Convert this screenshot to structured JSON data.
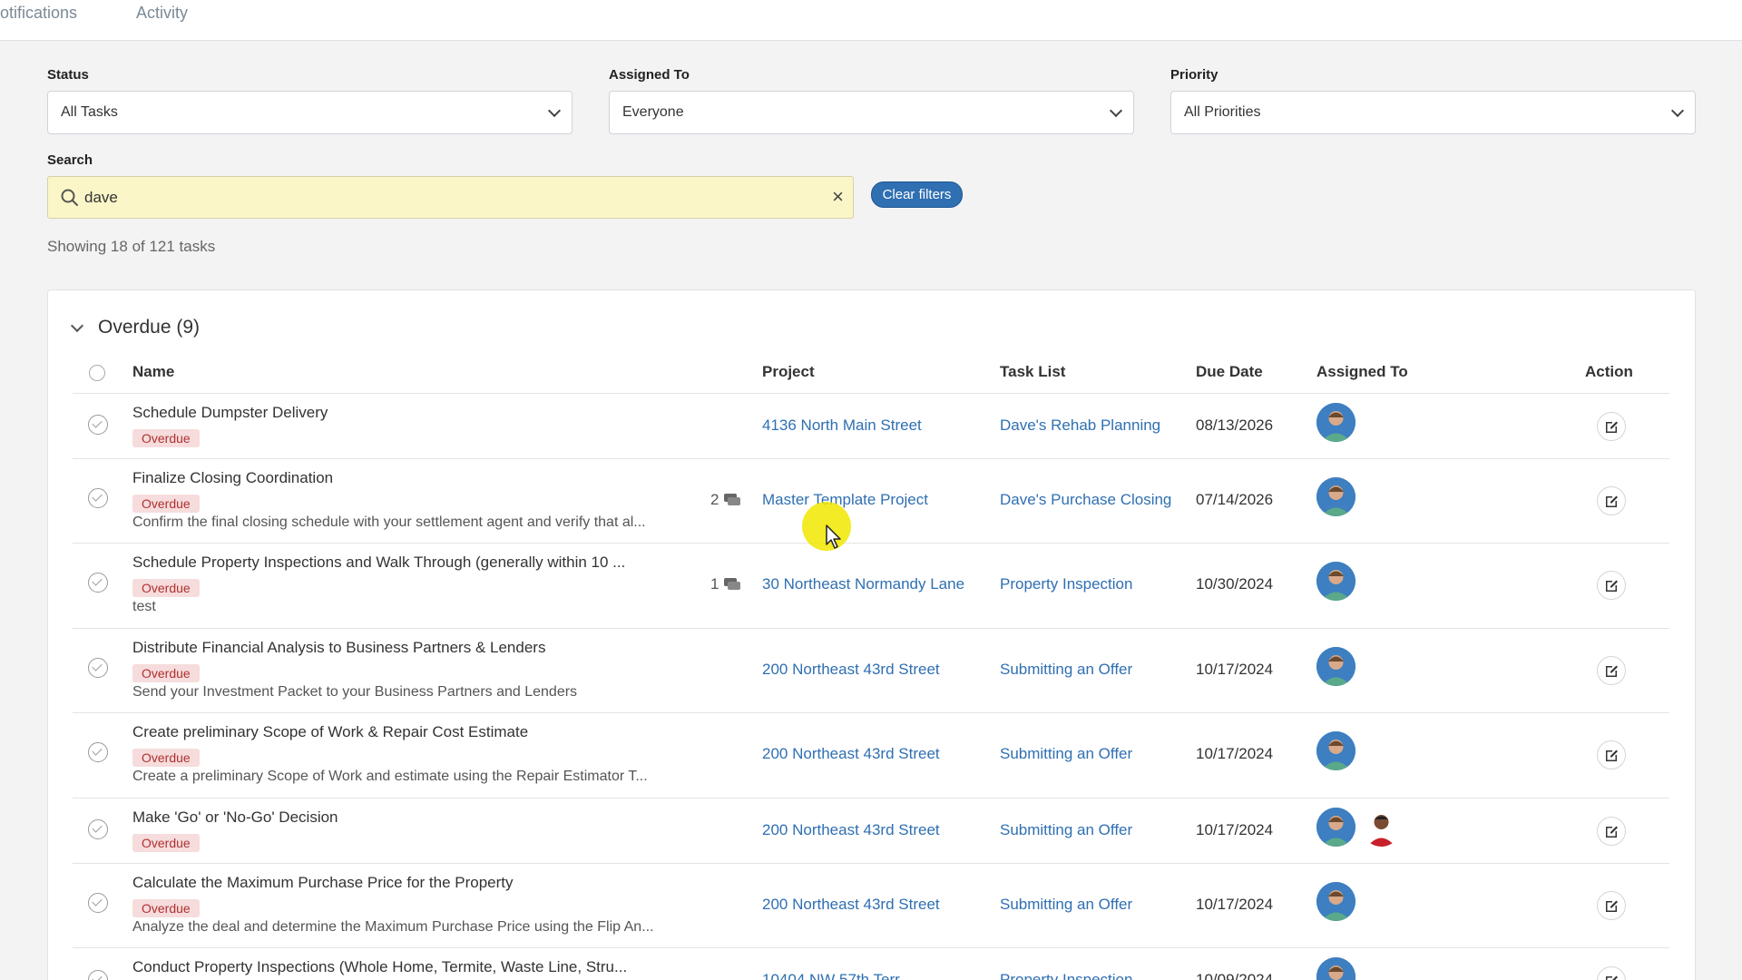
{
  "nav": {
    "tabs": [
      "otifications",
      "Activity"
    ]
  },
  "filters": {
    "status": {
      "label": "Status",
      "value": "All Tasks"
    },
    "assigned": {
      "label": "Assigned To",
      "value": "Everyone"
    },
    "priority": {
      "label": "Priority",
      "value": "All Priorities"
    },
    "search": {
      "label": "Search",
      "value": "dave"
    },
    "clear_label": "Clear filters"
  },
  "showing": "Showing 18 of 121 tasks",
  "group": {
    "title": "Overdue (9)"
  },
  "columns": {
    "name": "Name",
    "project": "Project",
    "tasklist": "Task List",
    "due": "Due Date",
    "assigned": "Assigned To",
    "action": "Action"
  },
  "rows": [
    {
      "name": "Schedule Dumpster Delivery",
      "badge": "Overdue",
      "desc": "",
      "count": "",
      "project": "4136 North Main Street",
      "tasklist": "Dave's Rehab Planning",
      "due": "08/13/2026",
      "second_avatar": false
    },
    {
      "name": "Finalize Closing Coordination",
      "badge": "Overdue",
      "desc": "Confirm the final closing schedule with your settlement agent and verify that al...",
      "count": "2",
      "project": "Master Template Project",
      "tasklist": "Dave's Purchase Closing",
      "due": "07/14/2026",
      "second_avatar": false
    },
    {
      "name": "Schedule Property Inspections and Walk Through (generally within 10 ...",
      "badge": "Overdue",
      "desc": "test",
      "count": "1",
      "project": "30 Northeast Normandy Lane",
      "tasklist": "Property Inspection",
      "due": "10/30/2024",
      "second_avatar": false
    },
    {
      "name": "Distribute Financial Analysis to Business Partners & Lenders",
      "badge": "Overdue",
      "desc": "Send your Investment Packet to your Business Partners and Lenders",
      "count": "",
      "project": "200 Northeast 43rd Street",
      "tasklist": "Submitting an Offer",
      "due": "10/17/2024",
      "second_avatar": false
    },
    {
      "name": "Create preliminary Scope of Work & Repair Cost Estimate",
      "badge": "Overdue",
      "desc": "Create a preliminary Scope of Work and estimate using the Repair Estimator T...",
      "count": "",
      "project": "200 Northeast 43rd Street",
      "tasklist": "Submitting an Offer",
      "due": "10/17/2024",
      "second_avatar": false
    },
    {
      "name": "Make 'Go' or 'No-Go' Decision",
      "badge": "Overdue",
      "desc": "",
      "count": "",
      "project": "200 Northeast 43rd Street",
      "tasklist": "Submitting an Offer",
      "due": "10/17/2024",
      "second_avatar": true
    },
    {
      "name": "Calculate the Maximum Purchase Price for the Property",
      "badge": "Overdue",
      "desc": "Analyze the deal and determine the Maximum Purchase Price using the Flip An...",
      "count": "",
      "project": "200 Northeast 43rd Street",
      "tasklist": "Submitting an Offer",
      "due": "10/17/2024",
      "second_avatar": false
    },
    {
      "name": "Conduct Property Inspections (Whole Home, Termite, Waste Line, Stru...",
      "badge": "",
      "desc": "",
      "count": "",
      "project": "10404 NW 57th Terr",
      "tasklist": "Property Inspection",
      "due": "10/09/2024",
      "second_avatar": false
    }
  ]
}
